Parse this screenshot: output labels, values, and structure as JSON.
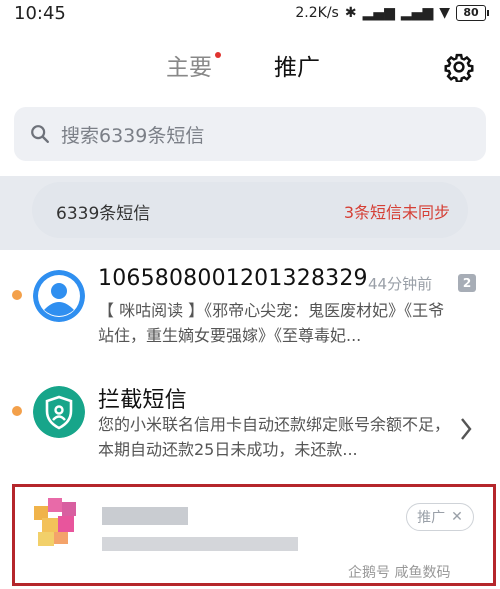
{
  "status_bar": {
    "time": "10:45",
    "network_speed": "2.2K/s",
    "battery": "80"
  },
  "tabs": [
    {
      "label": "主要",
      "has_dot": true
    },
    {
      "label": "推广",
      "selected": true
    }
  ],
  "search": {
    "placeholder": "搜索6339条短信"
  },
  "sync": {
    "count_text": "6339条短信",
    "warning_text": "3条短信未同步"
  },
  "messages": [
    {
      "sender": "10658080012013283​29",
      "time_ago": "44分钟前",
      "badge": "2",
      "preview": "【 咪咕阅读 】《邪帝心尖宠：鬼医废材妃》《王爷站住，重生嫡女要强嫁》《至尊毒妃..."
    },
    {
      "sender": "拦截短信",
      "preview": "您的小米联名信用卡自动还款绑定账号余额不足，本期自动还款25日未成功，未还款..."
    },
    {
      "promo_tag": "推广"
    }
  ],
  "watermark": "企鹅号 咸鱼数码",
  "colors": {
    "accent_red": "#e0332f",
    "warning_red": "#d53f35",
    "highlight_border": "#b5262b",
    "unread_dot": "#f3a04a",
    "avatar_blue": "#2f8ff0",
    "avatar_green": "#17a58a"
  }
}
